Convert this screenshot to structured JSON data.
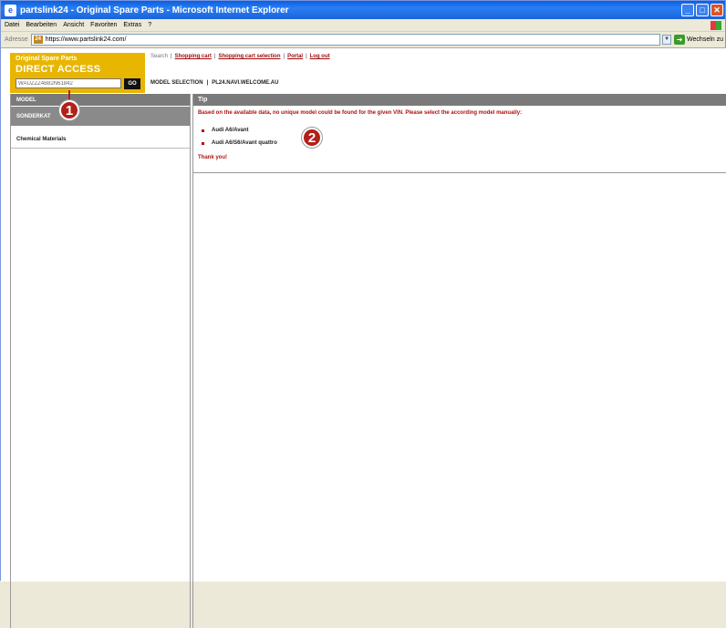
{
  "window": {
    "title": "partslink24 - Original Spare Parts - Microsoft Internet Explorer"
  },
  "menu": [
    "Datei",
    "Bearbeiten",
    "Ansicht",
    "Favoriten",
    "Extras",
    "?"
  ],
  "address": {
    "label": "Adresse",
    "url": "https://www.partslink24.com/",
    "go_label": "Wechseln zu"
  },
  "brand": {
    "small": "Original Spare Parts",
    "big": "DIRECT ACCESS"
  },
  "vin": {
    "value": "WAUZZZ4B82N61842",
    "go": "GO"
  },
  "toplinks": {
    "search": "Search",
    "cart": "Shopping cart",
    "cart_selection": "Shopping cart selection",
    "portal": "Portal",
    "logout": "Log out"
  },
  "model_selection": {
    "label": "MODEL SELECTION",
    "path": "PL24.NAVI.WELCOME.AU"
  },
  "sidebar": {
    "model": "MODEL",
    "sonderkat": "SONDERKAT",
    "chemical": "Chemical Materials"
  },
  "tip": {
    "header": "Tip",
    "message": "Based on the available data, no unique model could be found for the given VIN. Please select the according model manually:",
    "models": [
      "Audi A6/Avant",
      "Audi A6/S6/Avant quattro"
    ],
    "thanks": "Thank you!"
  },
  "callouts": [
    "1",
    "2"
  ]
}
